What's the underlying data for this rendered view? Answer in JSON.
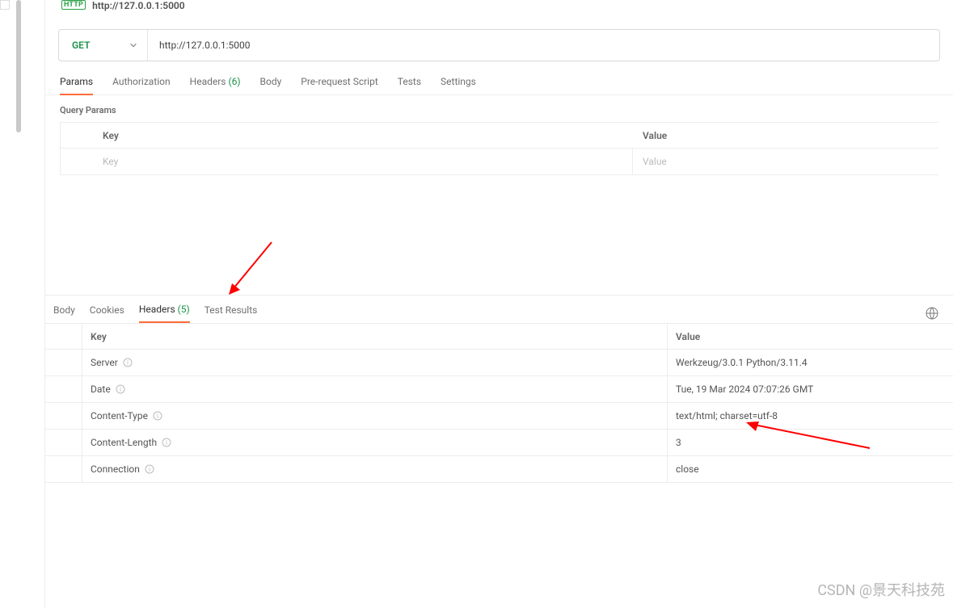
{
  "tab": {
    "badge": "HTTP",
    "title": "http://127.0.0.1:5000"
  },
  "request": {
    "method": "GET",
    "url": "http://127.0.0.1:5000"
  },
  "req_tabs": {
    "params": "Params",
    "authorization": "Authorization",
    "headers": "Headers",
    "headers_count": "(6)",
    "body": "Body",
    "prereq": "Pre-request Script",
    "tests": "Tests",
    "settings": "Settings"
  },
  "query": {
    "title": "Query Params",
    "key_header": "Key",
    "value_header": "Value",
    "key_placeholder": "Key",
    "value_placeholder": "Value"
  },
  "resp_tabs": {
    "body": "Body",
    "cookies": "Cookies",
    "headers": "Headers",
    "headers_count": "(5)",
    "test_results": "Test Results"
  },
  "resp_headers": {
    "key_header": "Key",
    "value_header": "Value",
    "rows": [
      {
        "key": "Server",
        "value": "Werkzeug/3.0.1 Python/3.11.4"
      },
      {
        "key": "Date",
        "value": "Tue, 19 Mar 2024 07:07:26 GMT"
      },
      {
        "key": "Content-Type",
        "value": "text/html; charset=utf-8"
      },
      {
        "key": "Content-Length",
        "value": "3"
      },
      {
        "key": "Connection",
        "value": "close"
      }
    ]
  },
  "watermark": "CSDN @景天科技苑"
}
